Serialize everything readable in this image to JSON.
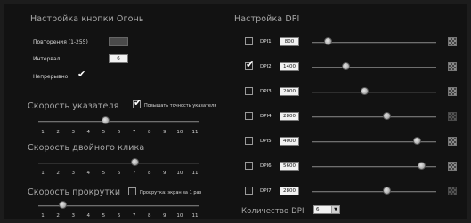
{
  "button_section": {
    "title": "Настройка кнопки Огонь",
    "repeats_label": "Повторения (1-255)",
    "repeats_value": "",
    "interval_label": "Интервал",
    "interval_value": "6",
    "continuous_label": "Непрерывно",
    "continuous_checked": true
  },
  "pointer_speed": {
    "title": "Скорость указателя",
    "precision_label": "Повышать точность указателя",
    "precision_checked": true,
    "value": 6,
    "ticks": [
      "1",
      "2",
      "3",
      "4",
      "5",
      "6",
      "7",
      "8",
      "9",
      "10",
      "11"
    ]
  },
  "double_click": {
    "title": "Скорость двойного клика",
    "value": 8
  },
  "scroll_speed": {
    "title": "Скорость прокрутки",
    "screen_scroll_label": "Прокрутка: экран за 1 раз",
    "screen_scroll_checked": false,
    "value": 3,
    "ticks": [
      "1",
      "2",
      "3",
      "4",
      "5",
      "6",
      "7",
      "8",
      "9",
      "10",
      "11"
    ]
  },
  "dpi_section": {
    "title": "Настройка DPI",
    "rows": [
      {
        "label": "DPI1",
        "value": "800",
        "checked": false,
        "fraction": 0.13
      },
      {
        "label": "DPI2",
        "value": "1400",
        "checked": true,
        "fraction": 0.27
      },
      {
        "label": "DPI3",
        "value": "2000",
        "checked": false,
        "fraction": 0.42
      },
      {
        "label": "DPI4",
        "value": "2800",
        "checked": false,
        "fraction": 0.6
      },
      {
        "label": "DPI5",
        "value": "4000",
        "checked": false,
        "fraction": 0.84
      },
      {
        "label": "DPI6",
        "value": "5600",
        "checked": false,
        "fraction": 0.88
      },
      {
        "label": "DPI7",
        "value": "2800",
        "checked": false,
        "fraction": 0.6
      }
    ],
    "count_label": "Количество DPI",
    "count_value": "6"
  }
}
